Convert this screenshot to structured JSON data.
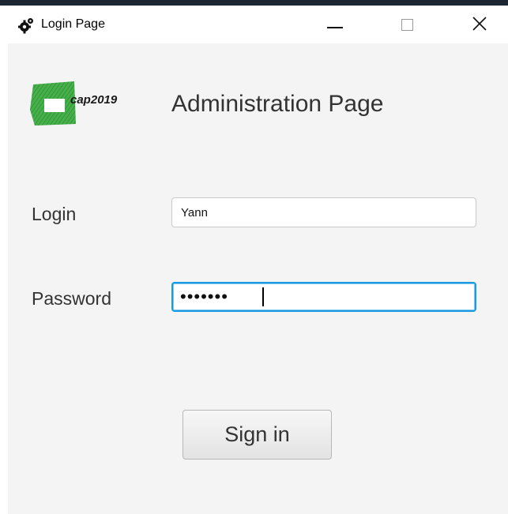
{
  "window": {
    "title": "Login Page",
    "controls": {
      "minimize_icon": "minimize-icon",
      "maximize_icon": "maximize-icon",
      "close_icon": "close-icon"
    }
  },
  "header": {
    "logo_text": "cap2019",
    "heading": "Administration Page"
  },
  "form": {
    "login_label": "Login",
    "login_value": "Yann",
    "password_label": "Password",
    "password_value": "•••••••",
    "submit_label": "Sign in"
  },
  "colors": {
    "focus_border": "#1a9ae0",
    "logo_green": "#3aa63a",
    "window_background": "#f4f4f4"
  }
}
